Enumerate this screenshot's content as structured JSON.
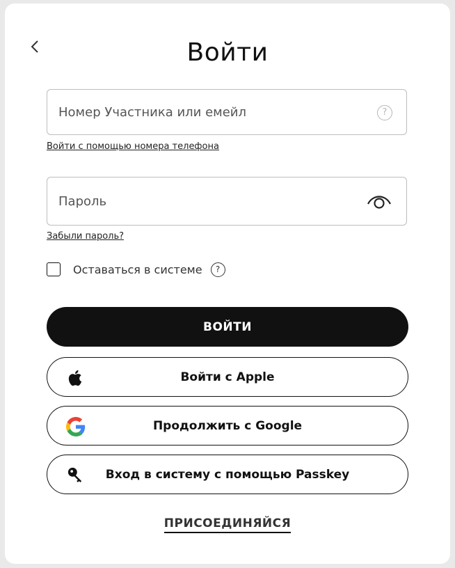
{
  "title": "Войти",
  "login_field": {
    "placeholder": "Номер Участника или емейл",
    "value": ""
  },
  "phone_link": "Войти с помощью номера телефона",
  "password_field": {
    "placeholder": "Пароль",
    "value": ""
  },
  "forgot_link": "Забыли пароль?",
  "remember": {
    "label": "Оставаться в системе",
    "checked": false,
    "help_glyph": "?"
  },
  "help_glyph": "?",
  "buttons": {
    "login": "ВОЙТИ",
    "apple": "Войти с Apple",
    "google": "Продолжить с Google",
    "passkey": "Вход в систему с помощью Passkey"
  },
  "join_link": "ПРИСОЕДИНЯЙСЯ",
  "colors": {
    "primary": "#111111",
    "background": "#ffffff",
    "page_bg": "#e9e9e9",
    "google_blue": "#4285F4",
    "google_red": "#EA4335",
    "google_yellow": "#FBBC05",
    "google_green": "#34A853"
  },
  "icons": [
    "back-chevron-icon",
    "help-icon",
    "eye-icon",
    "question-icon",
    "apple-icon",
    "google-icon",
    "key-icon"
  ]
}
